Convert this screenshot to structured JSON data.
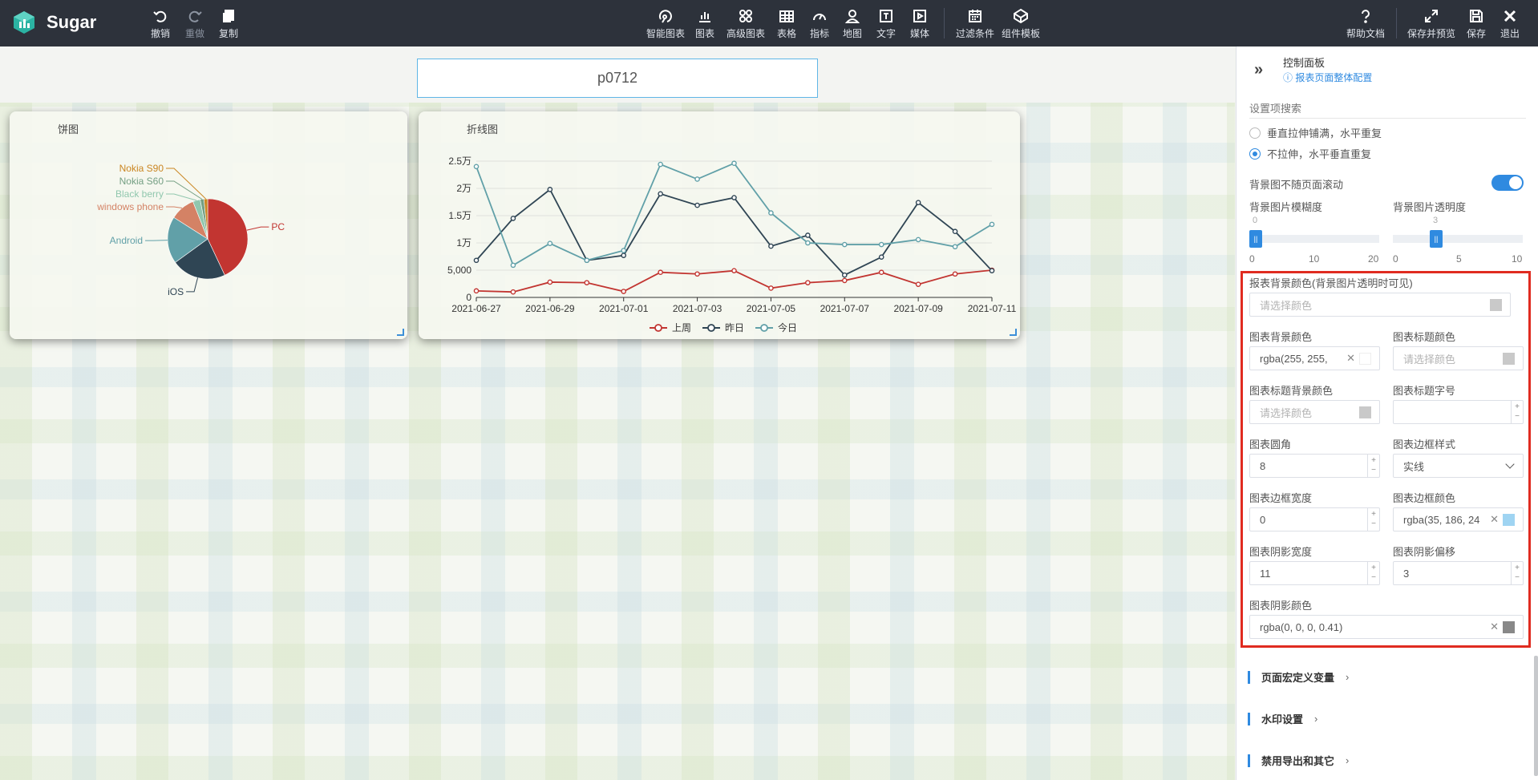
{
  "app": {
    "name": "Sugar",
    "logo_icon": "sugar-cube-logo"
  },
  "toolbar": {
    "left": [
      {
        "label": "撤销",
        "icon": "undo-icon"
      },
      {
        "label": "重做",
        "icon": "redo-icon",
        "disabled": true
      },
      {
        "label": "复制",
        "icon": "copy-icon"
      }
    ],
    "center": [
      {
        "label": "智能图表",
        "icon": "smart-chart-icon"
      },
      {
        "label": "图表",
        "icon": "bar-chart-icon"
      },
      {
        "label": "高级图表",
        "icon": "advanced-chart-icon"
      },
      {
        "label": "表格",
        "icon": "table-icon"
      },
      {
        "label": "指标",
        "icon": "gauge-icon"
      },
      {
        "label": "地图",
        "icon": "map-pin-icon"
      },
      {
        "label": "文字",
        "icon": "text-icon"
      },
      {
        "label": "媒体",
        "icon": "media-icon"
      },
      {
        "label": "过滤条件",
        "icon": "filter-calendar-icon"
      },
      {
        "label": "组件模板",
        "icon": "component-template-icon"
      }
    ],
    "right": [
      {
        "label": "帮助文档",
        "icon": "help-icon"
      },
      {
        "label": "保存并预览",
        "icon": "expand-icon"
      },
      {
        "label": "保存",
        "icon": "save-icon"
      },
      {
        "label": "退出",
        "icon": "close-icon"
      }
    ]
  },
  "canvas": {
    "page_title": "p0712"
  },
  "chart_data": [
    {
      "type": "pie",
      "title": "饼图",
      "slices": [
        {
          "label": "PC",
          "value": 43,
          "color": "#c23531"
        },
        {
          "label": "iOS",
          "value": 22,
          "color": "#2f4554"
        },
        {
          "label": "Android",
          "value": 19,
          "color": "#61a0a8"
        },
        {
          "label": "windows phone",
          "value": 10,
          "color": "#d48265"
        },
        {
          "label": "Black berry",
          "value": 3,
          "color": "#91c7ae"
        },
        {
          "label": "Nokia S60",
          "value": 1.5,
          "color": "#749f83"
        },
        {
          "label": "Nokia S90",
          "value": 1.5,
          "color": "#ca8622"
        }
      ]
    },
    {
      "type": "line",
      "title": "折线图",
      "x": [
        "2021-06-27",
        "2021-06-28",
        "2021-06-29",
        "2021-06-30",
        "2021-07-01",
        "2021-07-02",
        "2021-07-03",
        "2021-07-04",
        "2021-07-05",
        "2021-07-06",
        "2021-07-07",
        "2021-07-08",
        "2021-07-09",
        "2021-07-10",
        "2021-07-11"
      ],
      "x_tick_labels": [
        "2021-06-27",
        "2021-06-29",
        "2021-07-01",
        "2021-07-03",
        "2021-07-05",
        "2021-07-07",
        "2021-07-09",
        "2021-07-11"
      ],
      "y_tick_labels": [
        "0",
        "5,000",
        "1万",
        "1.5万",
        "2万",
        "2.5万"
      ],
      "ylim": [
        0,
        25000
      ],
      "series": [
        {
          "name": "上周",
          "color": "#c23531",
          "values": [
            1200,
            1000,
            2800,
            2700,
            1100,
            4600,
            4300,
            4900,
            1700,
            2700,
            3100,
            4600,
            2400,
            4300,
            5000
          ]
        },
        {
          "name": "昨日",
          "color": "#2f4554",
          "values": [
            6800,
            14500,
            19800,
            6800,
            7700,
            19000,
            16900,
            18300,
            9400,
            11400,
            4100,
            7400,
            17400,
            12100,
            4900
          ]
        },
        {
          "name": "今日",
          "color": "#61a0a8",
          "values": [
            24000,
            5900,
            9900,
            6800,
            8600,
            24400,
            21700,
            24600,
            15500,
            10000,
            9700,
            9700,
            10600,
            9300,
            13400
          ]
        }
      ]
    }
  ],
  "panel": {
    "title": "控制面板",
    "link": "报表页面整体配置",
    "search_placeholder": "设置项搜索",
    "radio1": "垂直拉伸铺满，水平重复",
    "radio2": "不拉伸，水平垂直重复",
    "fixed_bg_label": "背景图不随页面滚动",
    "blur_label": "背景图片模糊度",
    "blur_value": "0",
    "blur_ticks": [
      "0",
      "10",
      "20"
    ],
    "opacity_label": "背景图片透明度",
    "opacity_value": "3",
    "opacity_ticks": [
      "0",
      "5",
      "10"
    ],
    "report_bg_label": "报表背景颜色(背景图片透明时可见)",
    "report_bg_placeholder": "请选择颜色",
    "chart_bg_label": "图表背景颜色",
    "chart_bg_value": "rgba(255, 255,",
    "chart_title_color_label": "图表标题颜色",
    "chart_title_color_placeholder": "请选择颜色",
    "chart_title_bg_label": "图表标题背景颜色",
    "chart_title_bg_placeholder": "请选择颜色",
    "chart_title_size_label": "图表标题字号",
    "chart_title_size_value": "",
    "radius_label": "图表圆角",
    "radius_value": "8",
    "border_style_label": "图表边框样式",
    "border_style_value": "实线",
    "border_width_label": "图表边框宽度",
    "border_width_value": "0",
    "border_color_label": "图表边框颜色",
    "border_color_value": "rgba(35, 186, 24",
    "shadow_width_label": "图表阴影宽度",
    "shadow_width_value": "11",
    "shadow_offset_label": "图表阴影偏移",
    "shadow_offset_value": "3",
    "shadow_color_label": "图表阴影颜色",
    "shadow_color_value": "rgba(0, 0, 0, 0.41)",
    "sections": [
      "页面宏定义变量",
      "水印设置",
      "禁用导出和其它"
    ]
  }
}
